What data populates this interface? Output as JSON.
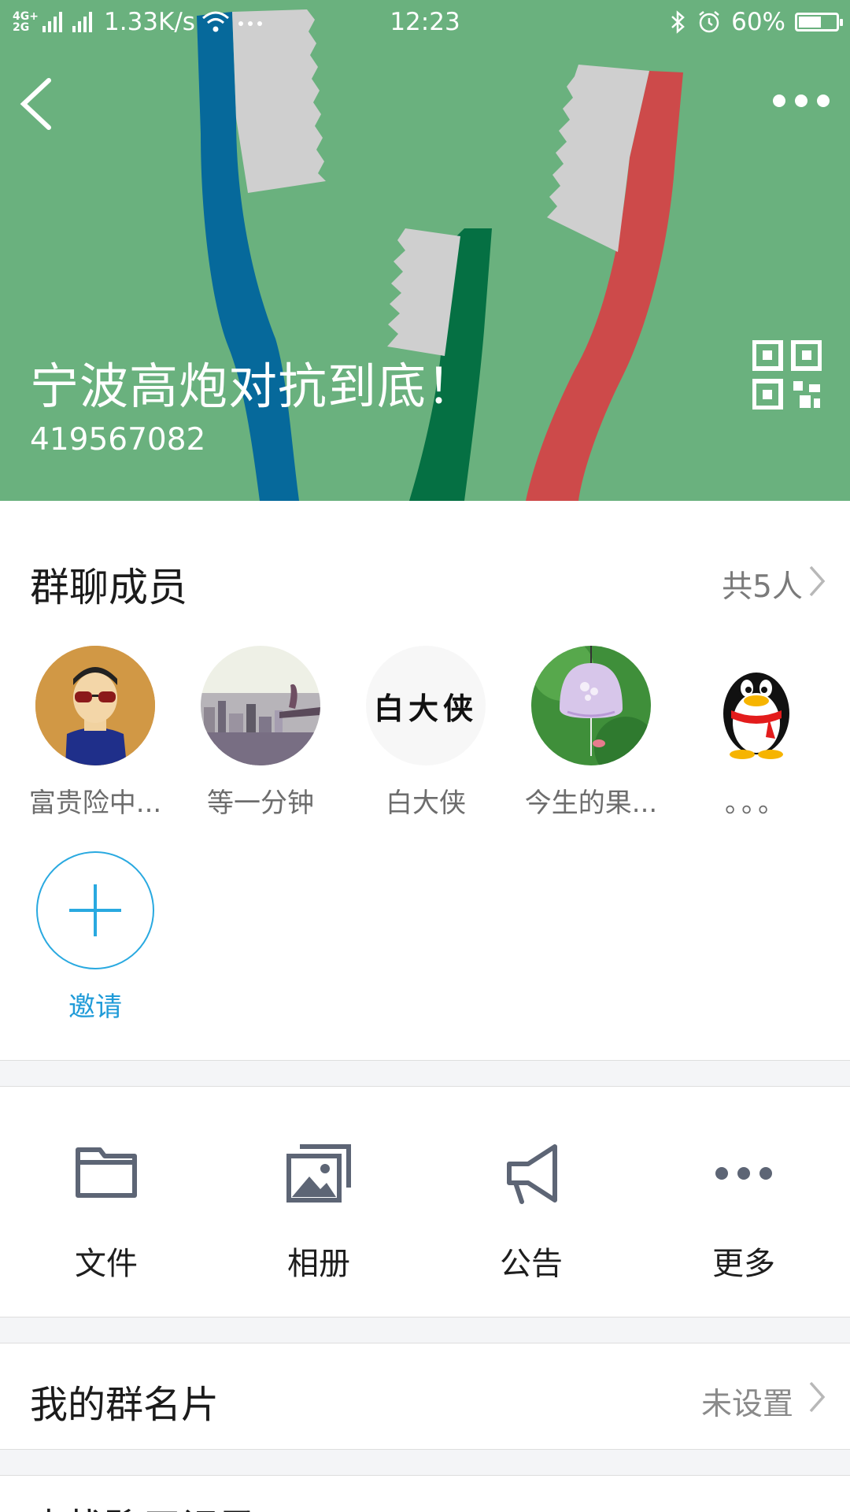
{
  "status_bar": {
    "network": "4G+ 2G",
    "speed": "1.33K/s",
    "time": "12:23",
    "battery": "60%",
    "battery_level": 0.6
  },
  "header": {
    "group_name": "宁波高炮对抗到底！",
    "group_id": "419567082",
    "colors": {
      "banner_bg": "#6ab17e",
      "brush_blue": "#06699b",
      "brush_green": "#057043",
      "brush_red": "#cd4a4a",
      "bristle": "#cfcfcf"
    }
  },
  "members": {
    "title": "群聊成员",
    "count_label": "共5人",
    "list": [
      {
        "name": "富贵险中...",
        "avatar": "person-sunglasses-avatar"
      },
      {
        "name": "等一分钟",
        "avatar": "city-view-avatar"
      },
      {
        "name": "白大侠",
        "avatar": "calligraphy-text-avatar",
        "avatar_text": "白大侠"
      },
      {
        "name": "今生的果...",
        "avatar": "wind-chime-avatar"
      },
      {
        "name": "。。。",
        "avatar": "qq-penguin-avatar"
      }
    ],
    "invite_label": "邀请"
  },
  "tools": [
    {
      "label": "文件",
      "icon": "folder-icon"
    },
    {
      "label": "相册",
      "icon": "album-icon"
    },
    {
      "label": "公告",
      "icon": "megaphone-icon"
    },
    {
      "label": "更多",
      "icon": "more-dots-icon"
    }
  ],
  "rows": {
    "my_card": {
      "label": "我的群名片",
      "value": "未设置"
    },
    "next_partial": {
      "label": "查找聊天记录"
    }
  },
  "accent_color": "#1f9bd8"
}
